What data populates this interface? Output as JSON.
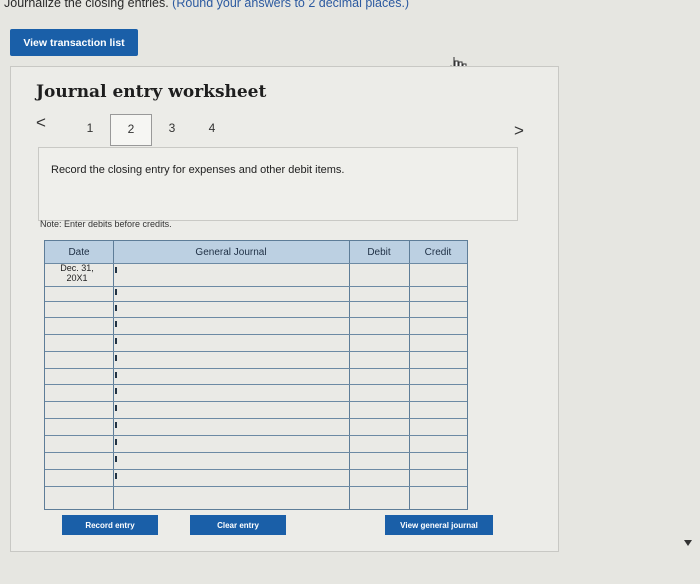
{
  "instruction": {
    "prefix": "Journalize the closing entries.",
    "note": "(Round your answers to 2 decimal places.)"
  },
  "view_transactions_label": "View transaction list",
  "worksheet": {
    "title": "Journal entry worksheet",
    "prev": "<",
    "next": ">",
    "pages": [
      "1",
      "2",
      "3",
      "4"
    ],
    "active_page": "2",
    "description": "Record the closing entry for expenses and other debit items.",
    "note": "Note: Enter debits before credits."
  },
  "grid": {
    "headers": {
      "date": "Date",
      "journal": "General Journal",
      "debit": "Debit",
      "credit": "Credit"
    },
    "date_value_line1": "Dec. 31,",
    "date_value_line2": "20X1"
  },
  "buttons": {
    "record": "Record entry",
    "clear": "Clear entry",
    "view_general": "View general journal"
  },
  "colors": {
    "accent": "#1a5fa8",
    "header_bg": "#bcd0e2"
  }
}
